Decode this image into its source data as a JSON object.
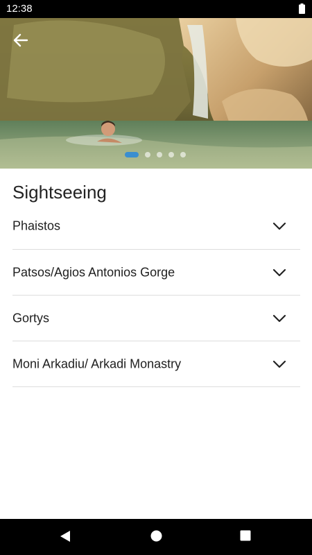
{
  "status_bar": {
    "time": "12:38",
    "battery_icon": "battery-full-icon"
  },
  "hero": {
    "back_icon": "arrow-left-icon",
    "slides_total": 5,
    "active_slide": 1
  },
  "section": {
    "title": "Sightseeing",
    "items": [
      {
        "label": "Phaistos",
        "icon": "chevron-down-icon"
      },
      {
        "label": "Patsos/Agios Antonios Gorge",
        "icon": "chevron-down-icon"
      },
      {
        "label": "Gortys",
        "icon": "chevron-down-icon"
      },
      {
        "label": "Moni Arkadiu/ Arkadi Monastry",
        "icon": "chevron-down-icon"
      }
    ]
  },
  "nav_bar": {
    "back_icon": "triangle-back-icon",
    "home_icon": "circle-home-icon",
    "recents_icon": "square-recents-icon"
  },
  "colors": {
    "accent": "#3a8ed0",
    "divider": "#dddddd",
    "text": "#1f1f1f"
  }
}
